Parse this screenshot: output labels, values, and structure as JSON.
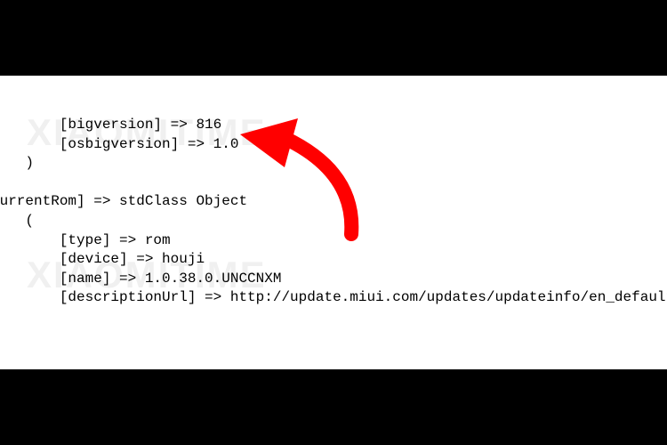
{
  "watermark": "XIAOMITIME",
  "code": {
    "l1": "        [bigversion] => 816",
    "l2": "        [osbigversion] => 1.0",
    "l3": "    )",
    "l4": "",
    "l5": "CurrentRom] => stdClass Object",
    "l6": "    (",
    "l7": "        [type] => rom",
    "l8": "        [device] => houji",
    "l9": "        [name] => 1.0.38.0.UNCCNXM",
    "l10": "        [descriptionUrl] => http://update.miui.com/updates/updateinfo/en_default.html"
  },
  "annotation": {
    "arrow_color": "#ff0000",
    "points_to": "osbigversion value 1.0"
  }
}
